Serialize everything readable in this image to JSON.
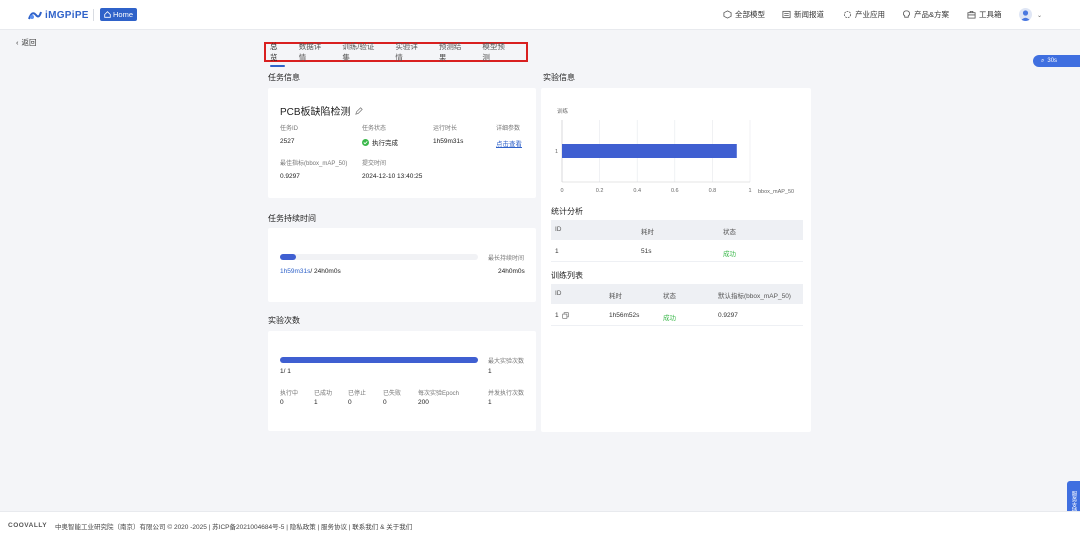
{
  "header": {
    "logo_text": "iMGPiPE",
    "home_label": "Home",
    "nav": [
      {
        "label": "全部模型",
        "icon": "cube-icon"
      },
      {
        "label": "新闻报道",
        "icon": "news-icon"
      },
      {
        "label": "产业应用",
        "icon": "gear-icon"
      },
      {
        "label": "产品&方案",
        "icon": "bulb-icon"
      },
      {
        "label": "工具箱",
        "icon": "toolbox-icon"
      }
    ]
  },
  "back_label": "返回",
  "tabs": [
    "总览",
    "数据详情",
    "训练/验证集",
    "实验详情",
    "预测结果",
    "模型预测"
  ],
  "float_pill": "30s",
  "task_info": {
    "section_title": "任务信息",
    "title": "PCB板缺陷检测",
    "fields": {
      "id_label": "任务ID",
      "id_value": "2527",
      "status_label": "任务状态",
      "status_value": "执行完成",
      "runtime_label": "运行时长",
      "runtime_value": "1h59m31s",
      "params_label": "详细参数",
      "params_value": "点击查看",
      "best_label": "最佳指标(bbox_mAP_50)",
      "best_value": "0.9297",
      "submit_label": "提交时间",
      "submit_value": "2024-12-10 13:40:25"
    }
  },
  "duration": {
    "section_title": "任务持续时间",
    "max_label": "最长持续时间",
    "progress_text": "1h59m31s",
    "progress_total": "/ 24h0m0s",
    "max_value": "24h0m0s",
    "progress_fraction": 0.083
  },
  "experiments": {
    "section_title": "实验次数",
    "max_label": "最大实验次数",
    "progress_text": "1/ 1",
    "max_value": "1",
    "progress_fraction": 1.0,
    "stats": [
      {
        "label": "执行中",
        "value": "0"
      },
      {
        "label": "已成功",
        "value": "1"
      },
      {
        "label": "已停止",
        "value": "0"
      },
      {
        "label": "已失败",
        "value": "0"
      },
      {
        "label": "每次实验Epoch",
        "value": "200"
      },
      {
        "label": "并发执行次数",
        "value": "1"
      }
    ]
  },
  "exp_info": {
    "section_title": "实验信息"
  },
  "chart_data": {
    "type": "bar",
    "orientation": "horizontal",
    "categories": [
      "1"
    ],
    "values": [
      0.9297
    ],
    "title": "",
    "ylabel": "训练",
    "xlabel": "bbox_mAP_50",
    "xlim": [
      0,
      1
    ],
    "xticks": [
      "0",
      "0.2",
      "0.4",
      "0.6",
      "0.8",
      "1"
    ],
    "grid": true,
    "bar_color": "#3f5fd1"
  },
  "stats_table": {
    "section_title": "统计分析",
    "headers": [
      "ID",
      "耗时",
      "状态"
    ],
    "rows": [
      [
        "1",
        "51s",
        "成功"
      ]
    ]
  },
  "train_table": {
    "section_title": "训练列表",
    "headers": [
      "ID",
      "耗时",
      "状态",
      "默认指标(bbox_mAP_50)"
    ],
    "rows": [
      [
        "1",
        "1h56m52s",
        "成功",
        "0.9297"
      ]
    ]
  },
  "footer": {
    "brand": "COOVALLY",
    "text": "中奥智能工业研究院（南京）有限公司 © 2020 -2025 | 苏ICP备2021004684号-5 | 隐私政策 | 服务协议 | 联系我们  &  关于我们"
  },
  "side_tab": "服务支持",
  "colors": {
    "accent": "#2f62c9",
    "bar": "#3f5fd1",
    "success": "#3ab84a",
    "highlight_box": "#d92020"
  }
}
